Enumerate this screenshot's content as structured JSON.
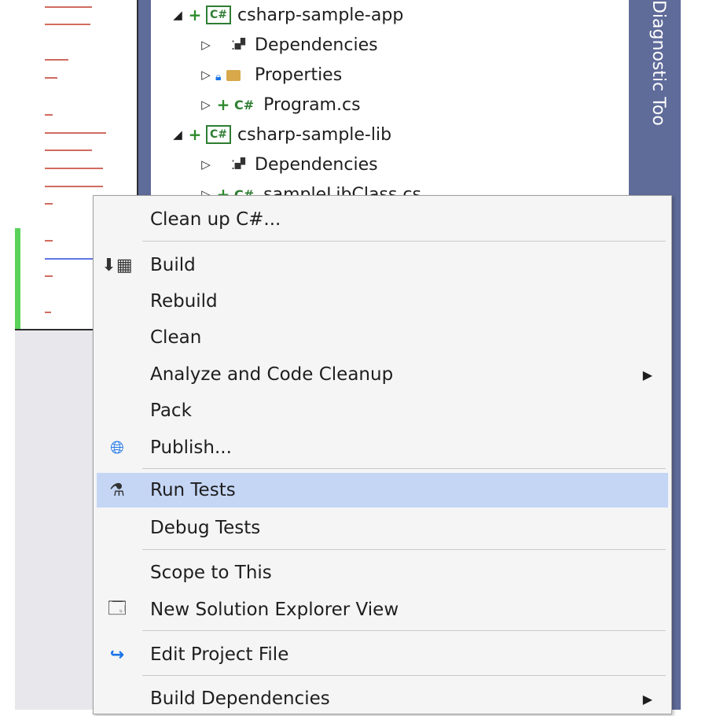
{
  "explorer": {
    "rows": [
      {
        "label": "csharp-sample-app",
        "kind": "project"
      },
      {
        "label": "Dependencies",
        "kind": "dependencies"
      },
      {
        "label": "Properties",
        "kind": "properties"
      },
      {
        "label": "Program.cs",
        "kind": "csfile"
      },
      {
        "label": "csharp-sample-lib",
        "kind": "project"
      },
      {
        "label": "Dependencies",
        "kind": "dependencies"
      },
      {
        "label": "sampleLibClass.cs",
        "kind": "csfile"
      }
    ],
    "cs_badge": "C#"
  },
  "side_tab": {
    "label": "Diagnostic Tools"
  },
  "menu": {
    "items": [
      {
        "label": "Clean up C#...",
        "icon": ""
      },
      {
        "label": "Build",
        "icon": "build-icon"
      },
      {
        "label": "Rebuild",
        "icon": ""
      },
      {
        "label": "Clean",
        "icon": ""
      },
      {
        "label": "Analyze and Code Cleanup",
        "icon": "",
        "submenu": true
      },
      {
        "label": "Pack",
        "icon": ""
      },
      {
        "label": "Publish...",
        "icon": "globe-icon"
      },
      {
        "label": "Run Tests",
        "icon": "flask-icon",
        "highlighted": true
      },
      {
        "label": "Debug Tests",
        "icon": ""
      },
      {
        "label": "Scope to This",
        "icon": ""
      },
      {
        "label": "New Solution Explorer View",
        "icon": "new-window-icon"
      },
      {
        "label": "Edit Project File",
        "icon": "edit-arrow-icon"
      },
      {
        "label": "Build Dependencies",
        "icon": "",
        "submenu": true
      }
    ]
  },
  "colors": {
    "highlight": "#c5d6f5",
    "tab_bg": "#5f6b99",
    "cs_green": "#2e7d32"
  }
}
